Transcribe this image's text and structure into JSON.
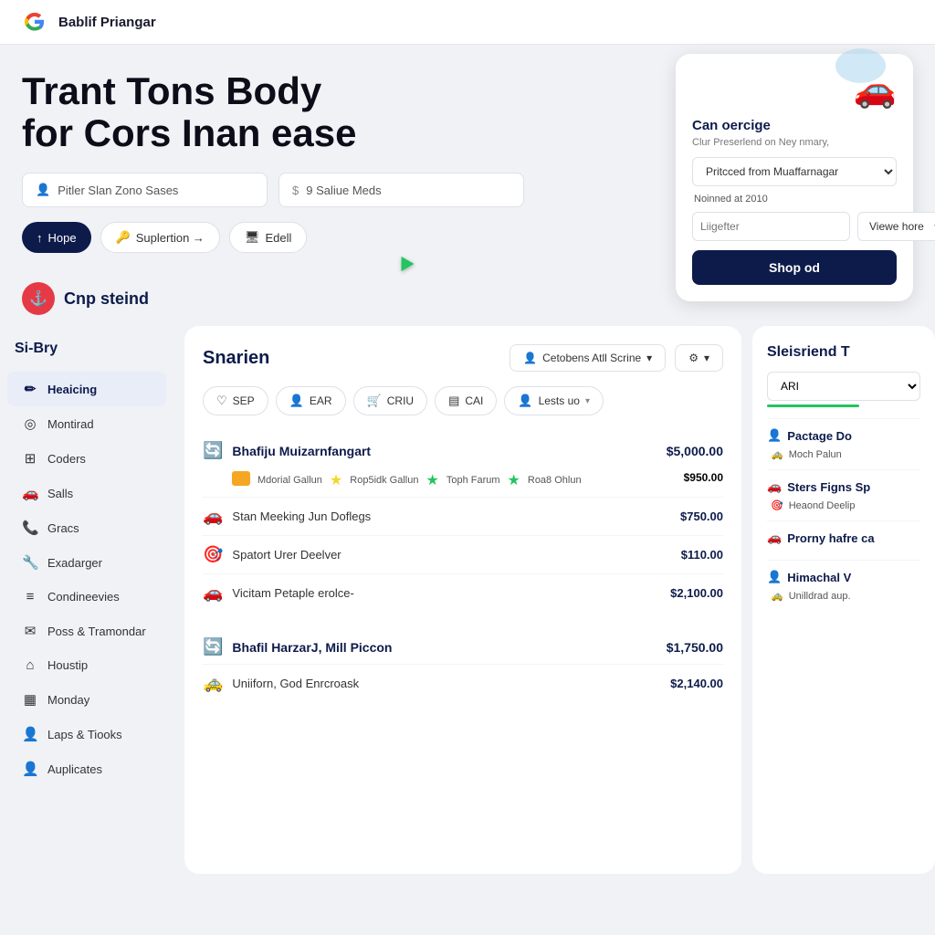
{
  "topbar": {
    "logo": "G",
    "title": "Bablif Priangar"
  },
  "hero": {
    "heading_line1": "Trant Tons Body",
    "heading_line2": "for Cors Inan ease",
    "search1_placeholder": "Pitler Slan Zono Sases",
    "search2_placeholder": "9 Saliue Meds",
    "filters": [
      {
        "label": "Hope",
        "active": true,
        "icon": "↑"
      },
      {
        "label": "Suplertion →",
        "active": false,
        "icon": "🔑"
      },
      {
        "label": "Edell",
        "active": false,
        "icon": "🖥"
      }
    ]
  },
  "car_card": {
    "name": "Can oercige",
    "subtitle": "Clur Preserlend on Ney nmary,",
    "select1_placeholder": "Pritcced from Muaffarnagar",
    "select1_sub": "Noinned at 2010",
    "input_placeholder": "Liigefter",
    "select2_placeholder": "Viewe hore",
    "button_label": "Shop od"
  },
  "company": {
    "icon": "⚓",
    "name": "Cnp steind"
  },
  "sidebar": {
    "title": "Si-Bry",
    "items": [
      {
        "label": "Heaicing",
        "icon": "✏️",
        "active": true
      },
      {
        "label": "Montirad",
        "icon": "⊙",
        "active": false
      },
      {
        "label": "Coders",
        "icon": "▦",
        "active": false
      },
      {
        "label": "Salls",
        "icon": "🚗",
        "active": false
      },
      {
        "label": "Gracs",
        "icon": "📞",
        "active": false
      },
      {
        "label": "Exadarger",
        "icon": "🔧",
        "active": false
      },
      {
        "label": "Condineevies",
        "icon": "▤",
        "active": false
      },
      {
        "label": "Poss & Tramondar",
        "icon": "✉",
        "active": false
      },
      {
        "label": "Houstip",
        "icon": "⌂",
        "active": false
      },
      {
        "label": "Monday",
        "icon": "▦",
        "active": false
      },
      {
        "label": "Laps & Tiooks",
        "icon": "👤",
        "active": false
      },
      {
        "label": "Auplicates",
        "icon": "👤",
        "active": false
      }
    ]
  },
  "center_panel": {
    "title": "Snarien",
    "actions": [
      {
        "label": "Cetobens Atll Scrine",
        "icon": "👤"
      },
      {
        "label": "⚙",
        "icon": ""
      }
    ],
    "filter_tabs": [
      {
        "label": "SEP",
        "icon": "♡"
      },
      {
        "label": "EAR",
        "icon": "👤"
      },
      {
        "label": "CRIU",
        "icon": "🛒"
      },
      {
        "label": "CAI",
        "icon": "▤"
      },
      {
        "label": "Lests uo",
        "icon": "👤"
      }
    ],
    "groups": [
      {
        "title": "Bhafiju Muizarnfangart",
        "amount": "$5,000.00",
        "icon": "🔄",
        "badges": [
          {
            "label": "Mdorial Gallun",
            "color": "#f5a623"
          },
          {
            "label": "Rop5idk Gallun",
            "color": "#f5d623"
          },
          {
            "label": "Toph Farum",
            "color": "#22c55e"
          },
          {
            "label": "Roa8 Ohlun",
            "color": "#22c55e"
          }
        ],
        "badge_amount": "$950.00",
        "items": [
          {
            "label": "Stan Meeking Jun Doflegs",
            "amount": "$750.00",
            "icon": "🚗"
          },
          {
            "label": "Spatort Urer Deelver",
            "amount": "$110.00",
            "icon": "🎯"
          },
          {
            "label": "Vicitam Petaple erolce-",
            "amount": "$2,100.00",
            "icon": "🚗"
          }
        ]
      },
      {
        "title": "Bhafil HarzarJ, Mill Piccon",
        "amount": "$1,750.00",
        "icon": "🔄",
        "items": [
          {
            "label": "Uniiforn, God Enrcroask",
            "amount": "$2,140.00",
            "icon": "🚕"
          }
        ]
      }
    ]
  },
  "right_panel": {
    "title": "Sleisriend T",
    "select_label": "ARI",
    "items": [
      {
        "title": "Pactage Do",
        "icon": "👤",
        "sub": "Moch Palun",
        "sub_icon": "🚕"
      },
      {
        "title": "Sters Figns Sp",
        "icon": "🚗",
        "sub": "Heaond Deelip",
        "sub_icon": "🎯"
      },
      {
        "title": "Prorny hafre ca",
        "icon": "🚗",
        "sub": "",
        "sub_icon": ""
      },
      {
        "title": "Himachal V",
        "icon": "👤",
        "sub": "Unilldrad aup.",
        "sub_icon": "🚕"
      }
    ]
  }
}
